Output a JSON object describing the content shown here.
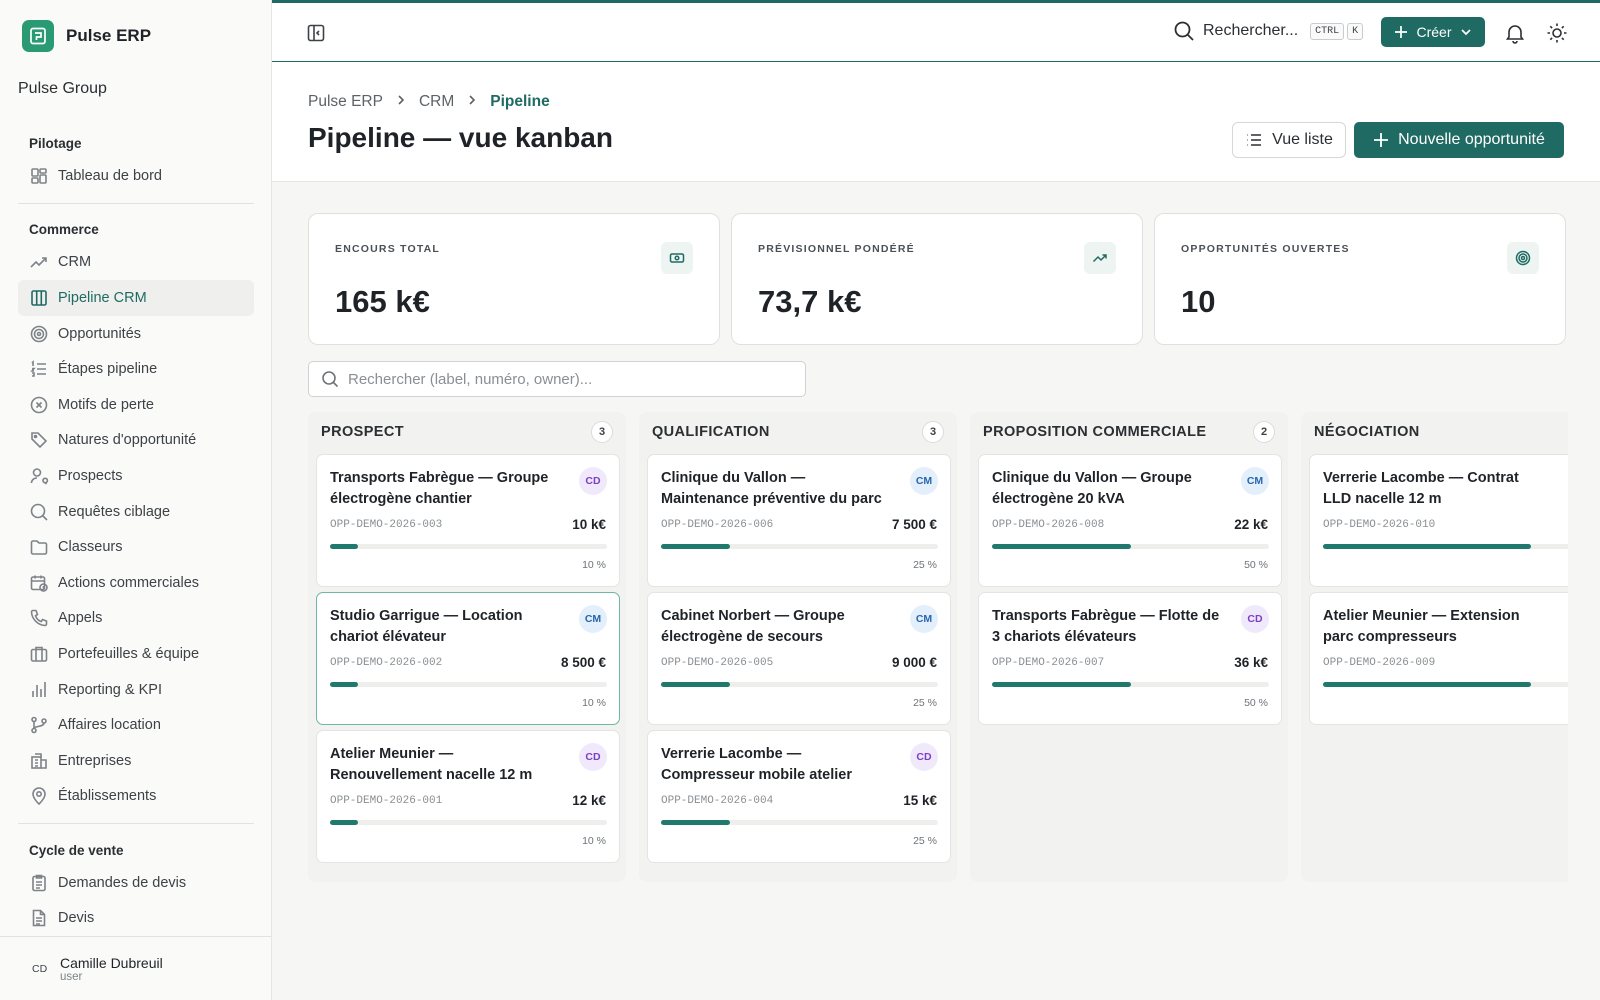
{
  "app": {
    "name": "Pulse ERP",
    "org": "Pulse Group"
  },
  "sidebar": {
    "sections": [
      {
        "title": "Pilotage",
        "items": [
          {
            "label": "Tableau de bord",
            "icon": "dashboard-icon"
          }
        ]
      },
      {
        "title": "Commerce",
        "items": [
          {
            "label": "CRM",
            "icon": "trend-icon"
          },
          {
            "label": "Pipeline CRM",
            "icon": "columns-icon",
            "active": true
          },
          {
            "label": "Opportunités",
            "icon": "target-icon"
          },
          {
            "label": "Étapes pipeline",
            "icon": "list-ordered-icon"
          },
          {
            "label": "Motifs de perte",
            "icon": "x-circle-icon"
          },
          {
            "label": "Natures d'opportunité",
            "icon": "tag-icon"
          },
          {
            "label": "Prospects",
            "icon": "user-search-icon"
          },
          {
            "label": "Requêtes ciblage",
            "icon": "search-icon"
          },
          {
            "label": "Classeurs",
            "icon": "folder-icon"
          },
          {
            "label": "Actions commerciales",
            "icon": "calendar-clock-icon"
          },
          {
            "label": "Appels",
            "icon": "phone-icon"
          },
          {
            "label": "Portefeuilles & équipe",
            "icon": "briefcase-icon"
          },
          {
            "label": "Reporting & KPI",
            "icon": "bar-chart-icon"
          },
          {
            "label": "Affaires location",
            "icon": "git-branch-icon"
          },
          {
            "label": "Entreprises",
            "icon": "building-icon"
          },
          {
            "label": "Établissements",
            "icon": "map-pin-icon"
          }
        ]
      },
      {
        "title": "Cycle de vente",
        "items": [
          {
            "label": "Demandes de devis",
            "icon": "clipboard-icon"
          },
          {
            "label": "Devis",
            "icon": "file-text-icon"
          }
        ]
      }
    ],
    "user": {
      "initials": "CD",
      "name": "Camille Dubreuil",
      "role": "user"
    }
  },
  "topbar": {
    "search_label": "Rechercher...",
    "shortcut": [
      "CTRL",
      "K"
    ],
    "create_label": "Créer"
  },
  "header": {
    "breadcrumb": [
      "Pulse ERP",
      "CRM",
      "Pipeline"
    ],
    "title": "Pipeline — vue kanban",
    "list_view_label": "Vue liste",
    "new_label": "Nouvelle opportunité"
  },
  "kpis": [
    {
      "label": "ENCOURS TOTAL",
      "value": "165 k€",
      "icon": "banknote-icon"
    },
    {
      "label": "PRÉVISIONNEL PONDÉRÉ",
      "value": "73,7 k€",
      "icon": "trending-up-icon"
    },
    {
      "label": "OPPORTUNITÉS OUVERTES",
      "value": "10",
      "icon": "target-icon"
    }
  ],
  "board_search": {
    "placeholder": "Rechercher (label, numéro, owner)..."
  },
  "columns": [
    {
      "title": "PROSPECT",
      "count": "3",
      "cards": [
        {
          "title": "Transports Fabrègue — Groupe électrogène chantier",
          "owner": "CD",
          "code": "OPP-DEMO-2026-003",
          "amount": "10 k€",
          "pct": "10 %",
          "probability": 0.1
        },
        {
          "title": "Studio Garrigue — Location chariot élévateur",
          "owner": "CM",
          "code": "OPP-DEMO-2026-002",
          "amount": "8 500 €",
          "pct": "10 %",
          "probability": 0.1,
          "selected": true
        },
        {
          "title": "Atelier Meunier — Renouvellement nacelle 12 m",
          "owner": "CD",
          "code": "OPP-DEMO-2026-001",
          "amount": "12 k€",
          "pct": "10 %",
          "probability": 0.1
        }
      ]
    },
    {
      "title": "QUALIFICATION",
      "count": "3",
      "cards": [
        {
          "title": "Clinique du Vallon — Maintenance préventive du parc",
          "owner": "CM",
          "code": "OPP-DEMO-2026-006",
          "amount": "7 500 €",
          "pct": "25 %",
          "probability": 0.25
        },
        {
          "title": "Cabinet Norbert — Groupe électrogène de secours",
          "owner": "CM",
          "code": "OPP-DEMO-2026-005",
          "amount": "9 000 €",
          "pct": "25 %",
          "probability": 0.25
        },
        {
          "title": "Verrerie Lacombe — Compresseur mobile atelier",
          "owner": "CD",
          "code": "OPP-DEMO-2026-004",
          "amount": "15 k€",
          "pct": "25 %",
          "probability": 0.25
        }
      ]
    },
    {
      "title": "PROPOSITION COMMERCIALE",
      "count": "2",
      "cards": [
        {
          "title": "Clinique du Vallon — Groupe électrogène 20 kVA",
          "owner": "CM",
          "code": "OPP-DEMO-2026-008",
          "amount": "22 k€",
          "pct": "50 %",
          "probability": 0.5
        },
        {
          "title": "Transports Fabrègue — Flotte de 3 chariots élévateurs",
          "owner": "CD",
          "code": "OPP-DEMO-2026-007",
          "amount": "36 k€",
          "pct": "50 %",
          "probability": 0.5
        }
      ]
    },
    {
      "title": "NÉGOCIATION",
      "count": "",
      "cards": [
        {
          "title": "Verrerie Lacombe — Contrat LLD nacelle 12 m",
          "owner": "",
          "code": "OPP-DEMO-2026-010",
          "amount": "",
          "pct": "",
          "probability": 0.75
        },
        {
          "title": "Atelier Meunier — Extension parc compresseurs",
          "owner": "",
          "code": "OPP-DEMO-2026-009",
          "amount": "",
          "pct": "",
          "probability": 0.75
        }
      ]
    }
  ]
}
